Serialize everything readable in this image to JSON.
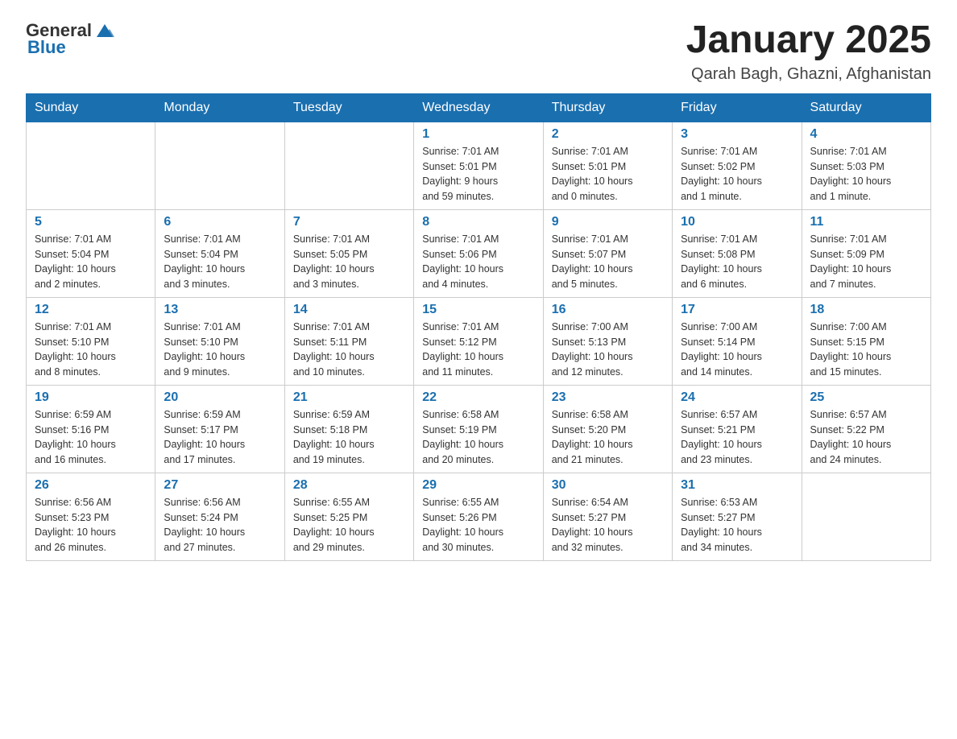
{
  "header": {
    "logo_general": "General",
    "logo_blue": "Blue",
    "title": "January 2025",
    "subtitle": "Qarah Bagh, Ghazni, Afghanistan"
  },
  "days_of_week": [
    "Sunday",
    "Monday",
    "Tuesday",
    "Wednesday",
    "Thursday",
    "Friday",
    "Saturday"
  ],
  "weeks": [
    [
      {
        "day": "",
        "info": ""
      },
      {
        "day": "",
        "info": ""
      },
      {
        "day": "",
        "info": ""
      },
      {
        "day": "1",
        "info": "Sunrise: 7:01 AM\nSunset: 5:01 PM\nDaylight: 9 hours\nand 59 minutes."
      },
      {
        "day": "2",
        "info": "Sunrise: 7:01 AM\nSunset: 5:01 PM\nDaylight: 10 hours\nand 0 minutes."
      },
      {
        "day": "3",
        "info": "Sunrise: 7:01 AM\nSunset: 5:02 PM\nDaylight: 10 hours\nand 1 minute."
      },
      {
        "day": "4",
        "info": "Sunrise: 7:01 AM\nSunset: 5:03 PM\nDaylight: 10 hours\nand 1 minute."
      }
    ],
    [
      {
        "day": "5",
        "info": "Sunrise: 7:01 AM\nSunset: 5:04 PM\nDaylight: 10 hours\nand 2 minutes."
      },
      {
        "day": "6",
        "info": "Sunrise: 7:01 AM\nSunset: 5:04 PM\nDaylight: 10 hours\nand 3 minutes."
      },
      {
        "day": "7",
        "info": "Sunrise: 7:01 AM\nSunset: 5:05 PM\nDaylight: 10 hours\nand 3 minutes."
      },
      {
        "day": "8",
        "info": "Sunrise: 7:01 AM\nSunset: 5:06 PM\nDaylight: 10 hours\nand 4 minutes."
      },
      {
        "day": "9",
        "info": "Sunrise: 7:01 AM\nSunset: 5:07 PM\nDaylight: 10 hours\nand 5 minutes."
      },
      {
        "day": "10",
        "info": "Sunrise: 7:01 AM\nSunset: 5:08 PM\nDaylight: 10 hours\nand 6 minutes."
      },
      {
        "day": "11",
        "info": "Sunrise: 7:01 AM\nSunset: 5:09 PM\nDaylight: 10 hours\nand 7 minutes."
      }
    ],
    [
      {
        "day": "12",
        "info": "Sunrise: 7:01 AM\nSunset: 5:10 PM\nDaylight: 10 hours\nand 8 minutes."
      },
      {
        "day": "13",
        "info": "Sunrise: 7:01 AM\nSunset: 5:10 PM\nDaylight: 10 hours\nand 9 minutes."
      },
      {
        "day": "14",
        "info": "Sunrise: 7:01 AM\nSunset: 5:11 PM\nDaylight: 10 hours\nand 10 minutes."
      },
      {
        "day": "15",
        "info": "Sunrise: 7:01 AM\nSunset: 5:12 PM\nDaylight: 10 hours\nand 11 minutes."
      },
      {
        "day": "16",
        "info": "Sunrise: 7:00 AM\nSunset: 5:13 PM\nDaylight: 10 hours\nand 12 minutes."
      },
      {
        "day": "17",
        "info": "Sunrise: 7:00 AM\nSunset: 5:14 PM\nDaylight: 10 hours\nand 14 minutes."
      },
      {
        "day": "18",
        "info": "Sunrise: 7:00 AM\nSunset: 5:15 PM\nDaylight: 10 hours\nand 15 minutes."
      }
    ],
    [
      {
        "day": "19",
        "info": "Sunrise: 6:59 AM\nSunset: 5:16 PM\nDaylight: 10 hours\nand 16 minutes."
      },
      {
        "day": "20",
        "info": "Sunrise: 6:59 AM\nSunset: 5:17 PM\nDaylight: 10 hours\nand 17 minutes."
      },
      {
        "day": "21",
        "info": "Sunrise: 6:59 AM\nSunset: 5:18 PM\nDaylight: 10 hours\nand 19 minutes."
      },
      {
        "day": "22",
        "info": "Sunrise: 6:58 AM\nSunset: 5:19 PM\nDaylight: 10 hours\nand 20 minutes."
      },
      {
        "day": "23",
        "info": "Sunrise: 6:58 AM\nSunset: 5:20 PM\nDaylight: 10 hours\nand 21 minutes."
      },
      {
        "day": "24",
        "info": "Sunrise: 6:57 AM\nSunset: 5:21 PM\nDaylight: 10 hours\nand 23 minutes."
      },
      {
        "day": "25",
        "info": "Sunrise: 6:57 AM\nSunset: 5:22 PM\nDaylight: 10 hours\nand 24 minutes."
      }
    ],
    [
      {
        "day": "26",
        "info": "Sunrise: 6:56 AM\nSunset: 5:23 PM\nDaylight: 10 hours\nand 26 minutes."
      },
      {
        "day": "27",
        "info": "Sunrise: 6:56 AM\nSunset: 5:24 PM\nDaylight: 10 hours\nand 27 minutes."
      },
      {
        "day": "28",
        "info": "Sunrise: 6:55 AM\nSunset: 5:25 PM\nDaylight: 10 hours\nand 29 minutes."
      },
      {
        "day": "29",
        "info": "Sunrise: 6:55 AM\nSunset: 5:26 PM\nDaylight: 10 hours\nand 30 minutes."
      },
      {
        "day": "30",
        "info": "Sunrise: 6:54 AM\nSunset: 5:27 PM\nDaylight: 10 hours\nand 32 minutes."
      },
      {
        "day": "31",
        "info": "Sunrise: 6:53 AM\nSunset: 5:27 PM\nDaylight: 10 hours\nand 34 minutes."
      },
      {
        "day": "",
        "info": ""
      }
    ]
  ]
}
